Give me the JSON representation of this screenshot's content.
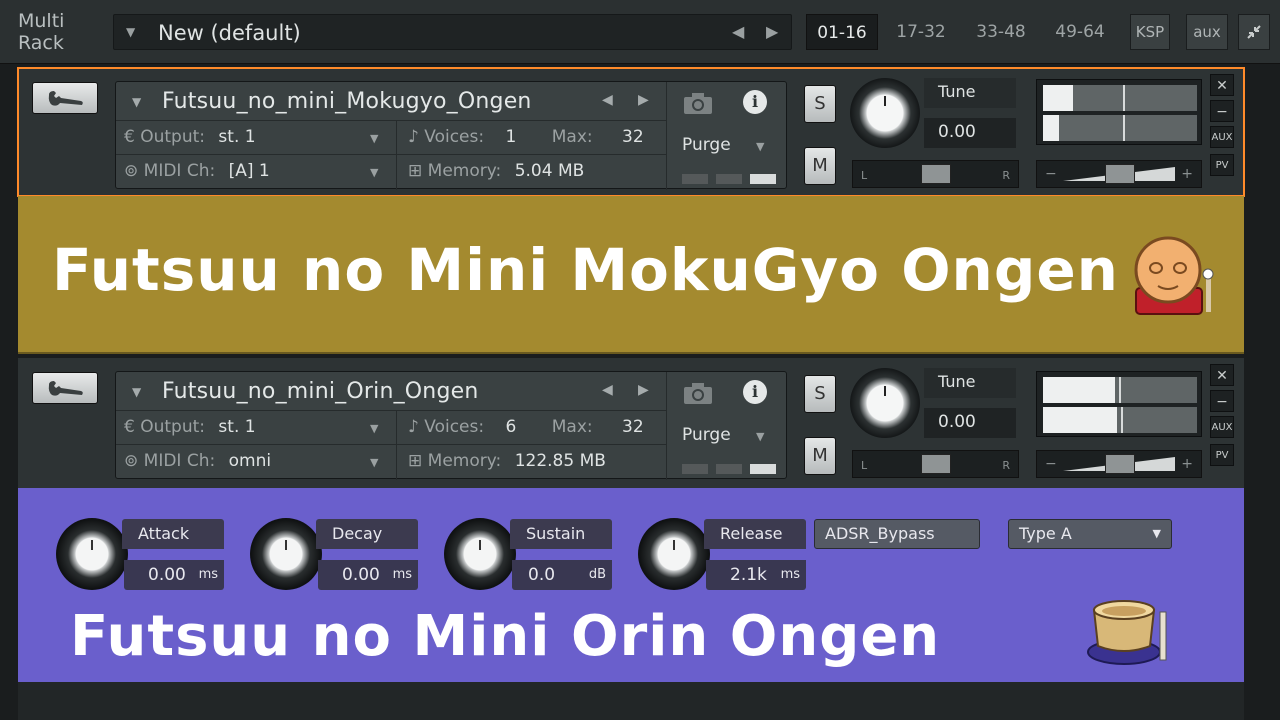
{
  "topbar": {
    "rack_title_line1": "Multi",
    "rack_title_line2": "Rack",
    "preset_name": "New (default)",
    "pages": [
      "01-16",
      "17-32",
      "33-48",
      "49-64"
    ],
    "active_page": "01-16",
    "ksp_label": "KSP",
    "aux_label": "aux"
  },
  "instruments": [
    {
      "name": "Futsuu_no_mini_Mokugyo_Ongen",
      "output_label": "Output:",
      "output": "st. 1",
      "voices_label": "Voices:",
      "voices": "1",
      "max_label": "Max:",
      "max": "32",
      "midi_label": "MIDI Ch:",
      "midi": "[A]  1",
      "memory_label": "Memory:",
      "memory": "5.04 MB",
      "purge": "Purge",
      "tune_label": "Tune",
      "tune_value": "0.00",
      "solo": "S",
      "mute": "M",
      "pan_l": "L",
      "pan_r": "R",
      "aux": "AUX",
      "pv": "PV",
      "meter_level": [
        0.2,
        0.1
      ]
    },
    {
      "name": "Futsuu_no_mini_Orin_Ongen",
      "output_label": "Output:",
      "output": "st. 1",
      "voices_label": "Voices:",
      "voices": "6",
      "max_label": "Max:",
      "max": "32",
      "midi_label": "MIDI Ch:",
      "midi": "omni",
      "memory_label": "Memory:",
      "memory": "122.85 MB",
      "purge": "Purge",
      "tune_label": "Tune",
      "tune_value": "0.00",
      "solo": "S",
      "mute": "M",
      "pan_l": "L",
      "pan_r": "R",
      "aux": "AUX",
      "pv": "PV",
      "meter_level": [
        0.5,
        0.5
      ]
    }
  ],
  "mokugyo_gui": {
    "title": "Futsuu no Mini MokuGyo Ongen",
    "bg_color": "#a48a2f"
  },
  "orin_gui": {
    "title": "Futsuu no Mini Orin Ongen",
    "bg_color": "#6a5fcc",
    "controls": [
      {
        "label": "Attack",
        "value": "0.00",
        "unit": "ms"
      },
      {
        "label": "Decay",
        "value": "0.00",
        "unit": "ms"
      },
      {
        "label": "Sustain",
        "value": "0.0",
        "unit": "dB"
      },
      {
        "label": "Release",
        "value": "2.1k",
        "unit": "ms"
      }
    ],
    "bypass_label": "ADSR_Bypass",
    "type_value": "Type A"
  },
  "accent_color": "#ff8a2a"
}
